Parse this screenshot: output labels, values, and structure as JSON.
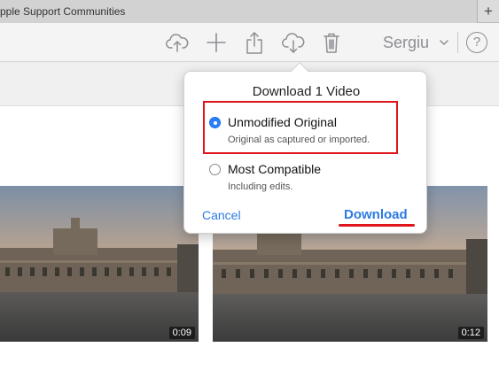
{
  "browser": {
    "tab_title": "pple Support Communities",
    "new_tab_label": "+"
  },
  "toolbar": {
    "icons": [
      "upload-cloud-icon",
      "plus-icon",
      "share-icon",
      "download-cloud-icon",
      "trash-icon"
    ],
    "user_name": "Sergiu",
    "help_label": "?"
  },
  "thumbnails": [
    {
      "duration": "0:09"
    },
    {
      "duration": "0:12"
    }
  ],
  "dialog": {
    "title": "Download 1 Video",
    "options": [
      {
        "label": "Unmodified Original",
        "description": "Original as captured or imported.",
        "selected": true
      },
      {
        "label": "Most Compatible",
        "description": "Including edits.",
        "selected": false
      }
    ],
    "cancel_label": "Cancel",
    "download_label": "Download"
  },
  "colors": {
    "accent": "#2b7be4",
    "annotation": "#e0141b"
  }
}
